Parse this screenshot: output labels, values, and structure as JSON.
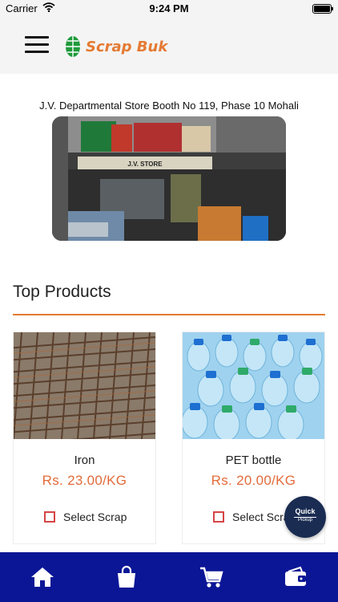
{
  "status_bar": {
    "carrier": "Carrier",
    "time": "9:24 PM"
  },
  "header": {
    "brand": "Scrap Buk"
  },
  "store": {
    "name": "J.V. Departmental Store Booth No 119, Phase 10 Mohali",
    "sign_text": "J.V. STORE"
  },
  "section": {
    "title": "Top Products"
  },
  "products": [
    {
      "name": "Iron",
      "price": "Rs. 23.00/KG",
      "select_label": "Select Scrap"
    },
    {
      "name": "PET bottle",
      "price": "Rs. 20.00/KG",
      "select_label": "Select Scrap"
    }
  ],
  "quick_pickup": {
    "line1": "Quick",
    "line2": "Pickup"
  },
  "bottom_nav": {
    "items": [
      "home-icon",
      "shopping-bag-icon",
      "cart-icon",
      "wallet-icon"
    ]
  },
  "colors": {
    "accent": "#e57a33",
    "price": "#e26b3b",
    "nav_bg": "#0b1696",
    "quick_pickup_bg": "#1a2c52",
    "checkbox": "#d64545"
  }
}
